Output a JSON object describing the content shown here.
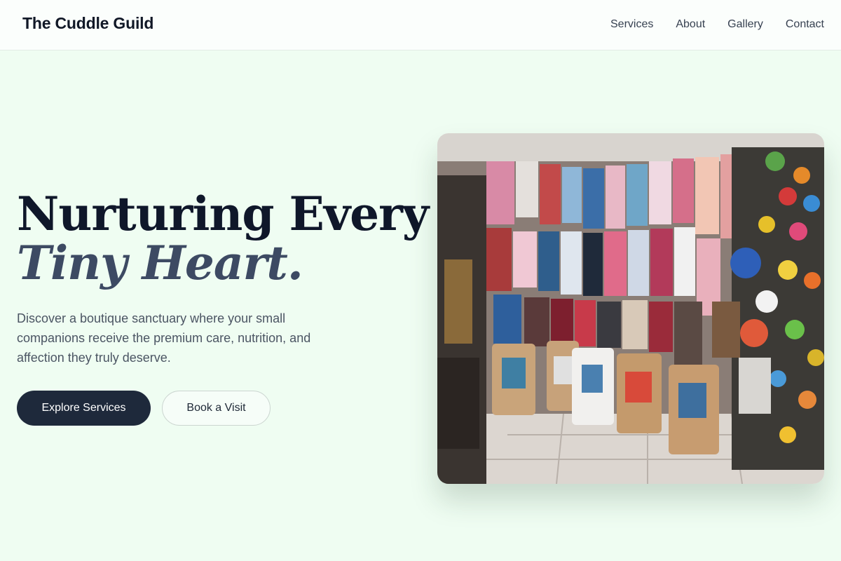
{
  "header": {
    "brand": "The Cuddle Guild",
    "nav": [
      "Services",
      "About",
      "Gallery",
      "Contact"
    ]
  },
  "hero": {
    "title_line1": "Nurturing Every",
    "title_line2": "Tiny Heart.",
    "description": "Discover a boutique sanctuary where your small companions receive the premium care, nutrition, and affection they truly deserve.",
    "primary_button": "Explore Services",
    "secondary_button": "Book a Visit"
  },
  "colors": {
    "background": "#effdf2",
    "primary": "#1e293b",
    "title": "#0f172a",
    "title_italic": "#3d4a63"
  }
}
